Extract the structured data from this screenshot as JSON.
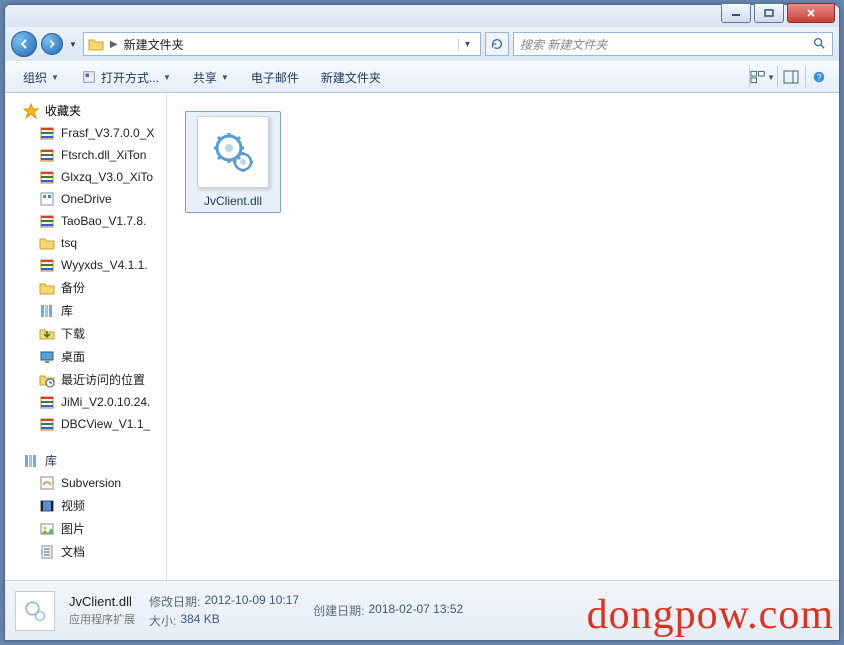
{
  "titlebar": {
    "min": "—",
    "max": "▢",
    "close": "✕"
  },
  "nav": {
    "folder_name": "新建文件夹",
    "separator": "▶",
    "dropdown": "▾",
    "refresh": "↻",
    "search_placeholder": "搜索 新建文件夹"
  },
  "toolbar": {
    "organize": "组织",
    "open_with": "打开方式...",
    "share": "共享",
    "email": "电子邮件",
    "new_folder": "新建文件夹"
  },
  "sidebar": {
    "favorites_label": "收藏夹",
    "favorites": [
      {
        "icon": "archive",
        "label": "Frasf_V3.7.0.0_X"
      },
      {
        "icon": "archive",
        "label": "Ftsrch.dll_XiTon"
      },
      {
        "icon": "archive",
        "label": "Glxzq_V3.0_XiTo"
      },
      {
        "icon": "app",
        "label": "OneDrive"
      },
      {
        "icon": "archive",
        "label": "TaoBao_V1.7.8."
      },
      {
        "icon": "folder",
        "label": "tsq"
      },
      {
        "icon": "archive",
        "label": "Wyyxds_V4.1.1."
      },
      {
        "icon": "folder",
        "label": "备份"
      },
      {
        "icon": "library",
        "label": "库"
      },
      {
        "icon": "download",
        "label": "下载"
      },
      {
        "icon": "desktop",
        "label": "桌面"
      },
      {
        "icon": "recent",
        "label": "最近访问的位置"
      },
      {
        "icon": "archive",
        "label": "JiMi_V2.0.10.24."
      },
      {
        "icon": "archive",
        "label": "DBCView_V1.1_"
      }
    ],
    "libraries_label": "库",
    "libraries": [
      {
        "icon": "svn",
        "label": "Subversion"
      },
      {
        "icon": "video",
        "label": "视频"
      },
      {
        "icon": "picture",
        "label": "图片"
      },
      {
        "icon": "doc",
        "label": "文档"
      }
    ]
  },
  "content": {
    "file_name": "JvClient.dll"
  },
  "details": {
    "file_name": "JvClient.dll",
    "file_type": "应用程序扩展",
    "modified_label": "修改日期:",
    "modified_value": "2012-10-09 10:17",
    "created_label": "创建日期:",
    "created_value": "2018-02-07 13:52",
    "size_label": "大小:",
    "size_value": "384 KB"
  },
  "watermark": "dongpow.com"
}
